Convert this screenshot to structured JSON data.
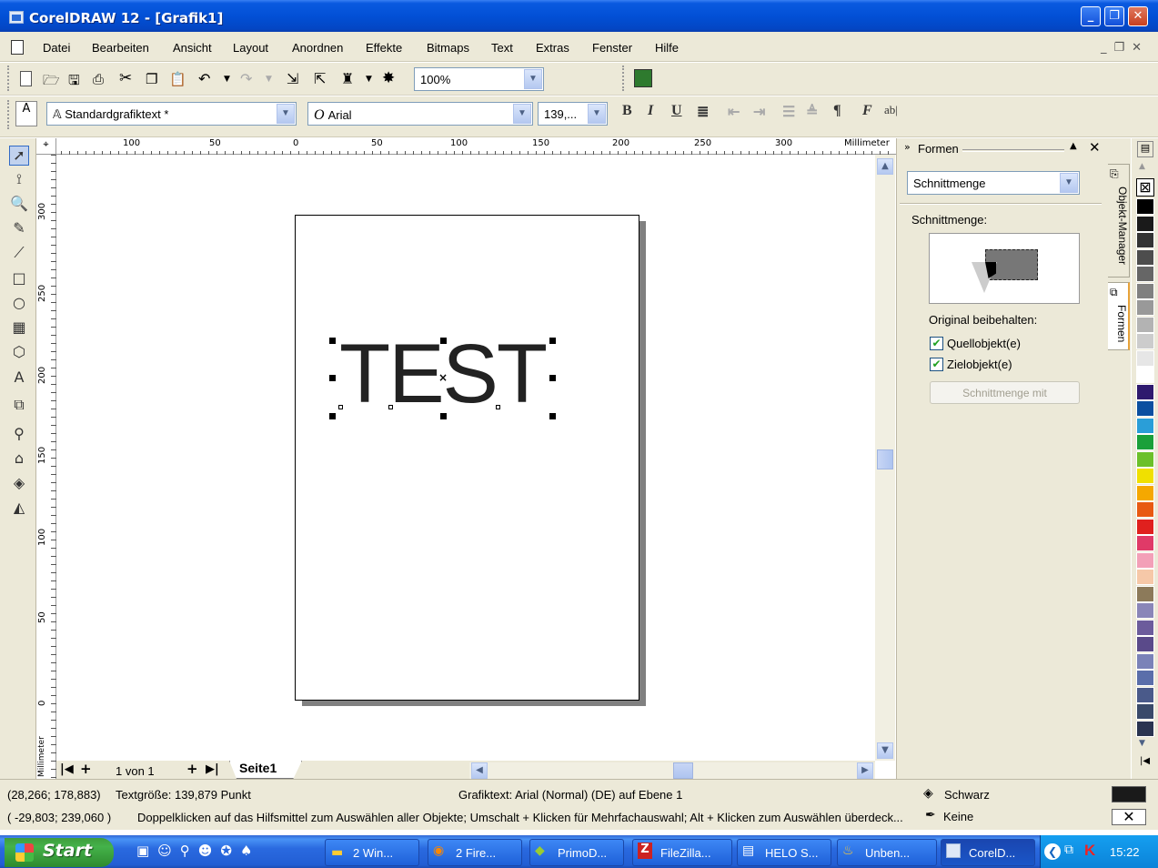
{
  "window": {
    "title": "CorelDRAW 12 - [Grafik1]"
  },
  "menu": [
    "Datei",
    "Bearbeiten",
    "Ansicht",
    "Layout",
    "Anordnen",
    "Effekte",
    "Bitmaps",
    "Text",
    "Extras",
    "Fenster",
    "Hilfe"
  ],
  "standard_toolbar": {
    "zoom": "100%"
  },
  "property_bar": {
    "text_style": "Standardgrafiktext *",
    "font": "Arial",
    "font_size": "139,..."
  },
  "ruler": {
    "h_ticks": [
      "100",
      "50",
      "0",
      "50",
      "100",
      "150",
      "200",
      "250",
      "300"
    ],
    "unit": "Millimeter",
    "v_ticks": [
      "300",
      "250",
      "200",
      "150",
      "100",
      "50",
      "0"
    ],
    "v_unit": "Millimeter"
  },
  "canvas": {
    "text": "TEST"
  },
  "page_nav": {
    "page_count": "1 von 1",
    "tab": "Seite1"
  },
  "docker": {
    "title": "Formen",
    "mode": "Schnittmenge",
    "preview_label": "Schnittmenge:",
    "keep_label": "Original beibehalten:",
    "source_label": "Quellobjekt(e)",
    "target_label": "Zielobjekt(e)",
    "action_button": "Schnittmenge mit",
    "tabs": [
      "Objekt-Manager",
      "Formen"
    ]
  },
  "palette_colors": [
    "#000000",
    "#1a1a1a",
    "#333333",
    "#4d4d4d",
    "#666666",
    "#808080",
    "#999999",
    "#b3b3b3",
    "#cccccc",
    "#e6e6e6",
    "#ffffff",
    "#2e1a6e",
    "#0b4fa0",
    "#2a9ed8",
    "#1aa03a",
    "#6cc02a",
    "#f0e000",
    "#f5a800",
    "#e85a12",
    "#e0201e",
    "#e03a68",
    "#f3a0b8",
    "#f6c8a8",
    "#8c7a5a",
    "#8a86b8",
    "#6c5c9c",
    "#5a4a8a",
    "#7a82b8",
    "#5a6eaa",
    "#4a5a8a",
    "#3a4a6a",
    "#2a3450"
  ],
  "status": {
    "coords": "(28,266; 178,883)",
    "text_size": "Textgröße: 139,879 Punkt",
    "object_info": "Grafiktext: Arial (Normal) (DE) auf Ebene 1",
    "fill": "Schwarz",
    "fill_color": "#1a1a1a",
    "coords2": "( -29,803; 239,060 )",
    "hint": "Doppelklicken auf das Hilfsmittel zum Auswählen aller Objekte; Umschalt + Klicken für Mehrfachauswahl; Alt + Klicken zum Auswählen überdeck...",
    "outline": "Keine"
  },
  "taskbar": {
    "start": "Start",
    "tasks": [
      "2 Win...",
      "2 Fire...",
      "PrimoD...",
      "FileZilla...",
      "HELO S...",
      "Unben...",
      "CorelD..."
    ],
    "clock": "15:22"
  }
}
